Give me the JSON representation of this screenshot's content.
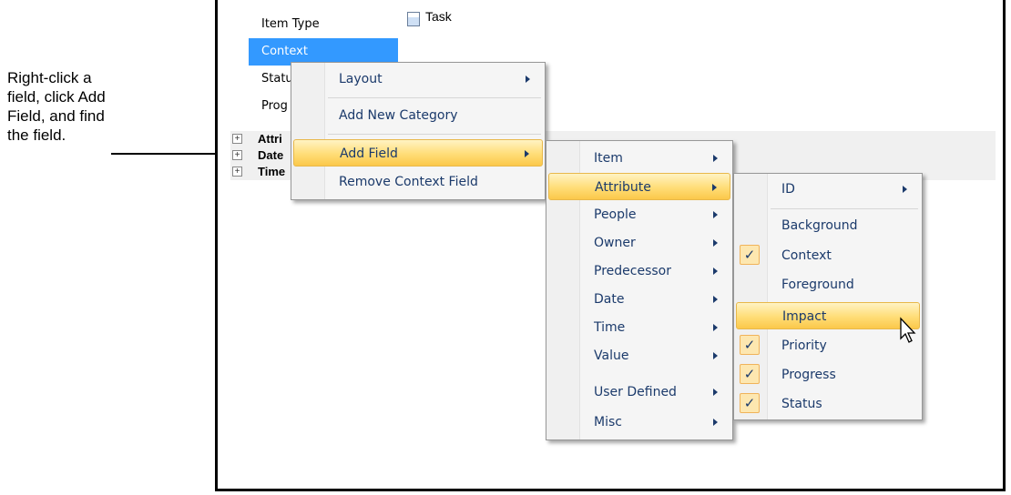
{
  "callout": {
    "lines": [
      "Right-click a",
      "field, click Add",
      "Field, and find",
      "the field."
    ]
  },
  "properties": {
    "item_type_label": "Item Type",
    "item_type_value": "Task",
    "context_label": "Context",
    "status_label": "Statu",
    "progress_label": "Prog"
  },
  "categories": [
    "Attri",
    "Date",
    "Time"
  ],
  "context_menu": {
    "layout": "Layout",
    "add_category": "Add New Category",
    "add_field": "Add Field",
    "remove_field": "Remove Context Field"
  },
  "field_groups": [
    "Item",
    "Attribute",
    "People",
    "Owner",
    "Predecessor",
    "Date",
    "Time",
    "Value",
    "User Defined",
    "Misc"
  ],
  "attributes": {
    "id": "ID",
    "items": [
      {
        "label": "Background",
        "checked": false
      },
      {
        "label": "Context",
        "checked": true
      },
      {
        "label": "Foreground",
        "checked": false
      },
      {
        "label": "Impact",
        "checked": false
      },
      {
        "label": "Priority",
        "checked": true
      },
      {
        "label": "Progress",
        "checked": true
      },
      {
        "label": "Status",
        "checked": true
      }
    ],
    "check_glyph": "✓"
  },
  "colors": {
    "selection": "#3399ff",
    "menu_text": "#1b3a6b",
    "highlight": "#ffdd77"
  }
}
